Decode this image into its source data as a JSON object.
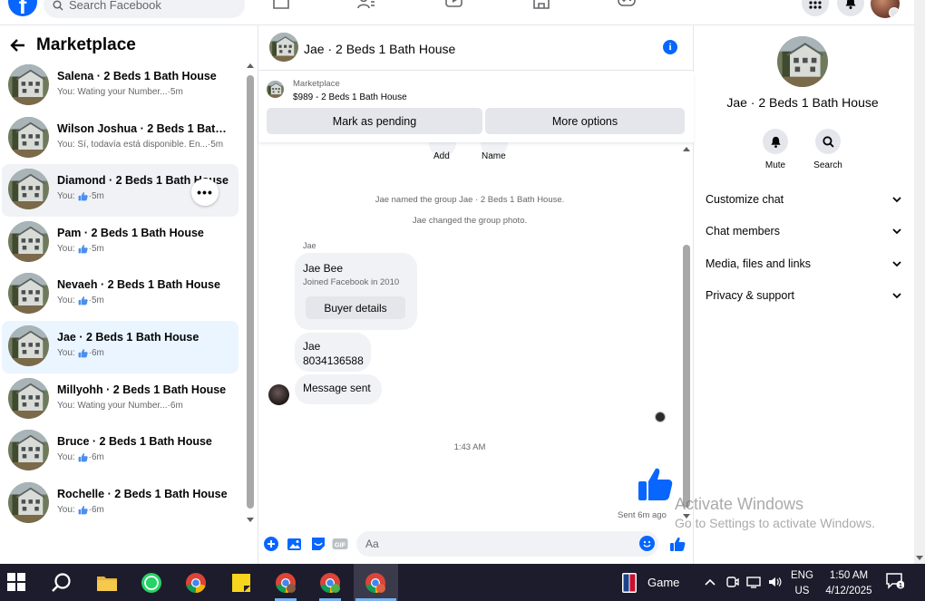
{
  "topbar": {
    "logo": "f",
    "search_placeholder": "Search Facebook"
  },
  "left": {
    "title": "Marketplace",
    "threads": [
      {
        "name": "Salena · 2 Beds 1 Bath House",
        "sub_prefix": "You: Wating your Number...",
        "like": false,
        "time": "5m"
      },
      {
        "name": "Wilson Joshua · 2 Beds 1 Bath H...",
        "sub_prefix": "You: Sí, todavía está disponible. En...",
        "like": false,
        "time": "5m"
      },
      {
        "name": "Diamond · 2 Beds 1 Bath House",
        "sub_prefix": "You:",
        "like": true,
        "time": "5m"
      },
      {
        "name": "Pam · 2 Beds 1 Bath House",
        "sub_prefix": "You:",
        "like": true,
        "time": "5m"
      },
      {
        "name": "Nevaeh · 2 Beds 1 Bath House",
        "sub_prefix": "You:",
        "like": true,
        "time": "5m"
      },
      {
        "name": "Jae · 2 Beds 1 Bath House",
        "sub_prefix": "You:",
        "like": true,
        "time": "6m"
      },
      {
        "name": "Millyohh · 2 Beds 1 Bath House",
        "sub_prefix": "You: Wating your Number...",
        "like": false,
        "time": "6m"
      },
      {
        "name": "Bruce · 2 Beds 1 Bath House",
        "sub_prefix": "You:",
        "like": true,
        "time": "6m"
      },
      {
        "name": "Rochelle · 2 Beds 1 Bath House",
        "sub_prefix": "You:",
        "like": true,
        "time": "6m"
      }
    ],
    "more_dots": "•••"
  },
  "chat": {
    "header_title": "Jae · 2 Beds 1 Bath House",
    "info": "i",
    "marketplace_label": "Marketplace",
    "listing": "$989 - 2 Beds 1 Bath House",
    "mark_pending": "Mark as pending",
    "more_options": "More options",
    "add_label": "Add",
    "name_label": "Name",
    "sys_named": "Jae named the group Jae · 2 Beds 1 Bath House.",
    "sys_photo": "Jae changed the group photo.",
    "sender": "Jae",
    "card_name": "Jae  Bee",
    "card_joined": "Joined Facebook in 2010",
    "buyer_details": "Buyer details",
    "msg_name": "Jae",
    "msg_phone": "8034136588",
    "msg_sent": "Message sent",
    "time": "1:43 AM",
    "sent_ago": "Sent 6m ago",
    "composer_placeholder": "Aa",
    "gif": "GIF"
  },
  "right": {
    "title": "Jae · 2 Beds 1 Bath House",
    "mute": "Mute",
    "search": "Search",
    "menu": [
      "Customize chat",
      "Chat members",
      "Media, files and links",
      "Privacy & support"
    ]
  },
  "watermark": {
    "line1": "Activate Windows",
    "line2": "Go to Settings to activate Windows."
  },
  "taskbar": {
    "game": "Game",
    "lang1": "ENG",
    "lang2": "US",
    "time": "1:50 AM",
    "date": "4/12/2025",
    "notif_count": "1"
  },
  "colors": {
    "accent": "#0866ff",
    "taskbar": "#1c1c2c"
  }
}
